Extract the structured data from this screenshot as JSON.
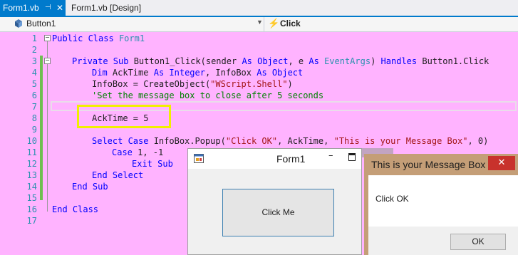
{
  "tabs": [
    {
      "label": "Form1.vb",
      "active": true
    },
    {
      "label": "Form1.vb [Design]",
      "active": false
    }
  ],
  "nav": {
    "object_label": "Button1",
    "object_icon": "cube-icon",
    "event_label": "Click",
    "event_icon": "lightning-bolt-icon"
  },
  "editor": {
    "line_numbers": [
      "1",
      "2",
      "3",
      "4",
      "5",
      "6",
      "7",
      "8",
      "9",
      "10",
      "11",
      "12",
      "13",
      "14",
      "15",
      "16",
      "17"
    ],
    "lines": {
      "l1": {
        "kw": "Public Class",
        "name": "Form1"
      },
      "l3": {
        "kw1": "Private Sub",
        "mid": " Button1_Click(sender ",
        "kw2": "As Object",
        "mid2": ", e ",
        "kw3": "As",
        "type": "EventArgs",
        "mid3": ") ",
        "kw4": "Handles",
        "tail": " Button1.Click"
      },
      "l4": {
        "kw1": "Dim",
        "mid": " AckTime ",
        "kw2": "As Integer",
        "mid2": ", InfoBox ",
        "kw3": "As Object"
      },
      "l5": {
        "pre": "InfoBox = CreateObject(",
        "str": "\"WScript.Shell\"",
        "post": ")"
      },
      "l6": {
        "comment": "'Set the message box to close after 5 seconds"
      },
      "l8": {
        "text": "AckTime = 5"
      },
      "l10": {
        "kw": "Select Case",
        "pre": " InfoBox.Popup(",
        "str1": "\"Click OK\"",
        "mid": ", AckTime, ",
        "str2": "\"This is your Message Box\"",
        "post": ", 0)"
      },
      "l11": {
        "kw": "Case",
        "text": " 1, -1"
      },
      "l12": {
        "kw": "Exit Sub"
      },
      "l13": {
        "kw": "End Select"
      },
      "l14": {
        "kw": "End Sub"
      },
      "l16": {
        "kw": "End Class"
      }
    }
  },
  "form1": {
    "title": "Form1",
    "minimize": "–",
    "button_label": "Click Me"
  },
  "msgbox": {
    "title": "This is your Message Box",
    "close": "✕",
    "message": "Click OK",
    "ok_label": "OK"
  },
  "colors": {
    "editor_background": "#ffb3ff",
    "tab_accent": "#007acc",
    "highlight": "#f0f000",
    "keyword": "#0000ff",
    "string": "#a31515",
    "comment": "#008000",
    "type": "#2b91af"
  }
}
